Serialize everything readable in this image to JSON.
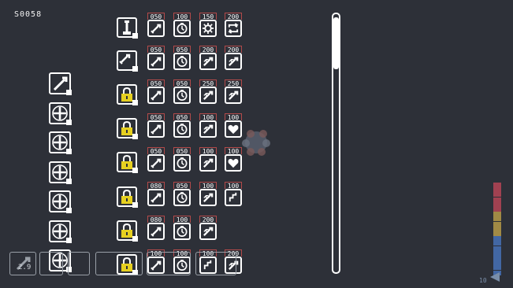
{
  "hud": {
    "counter": "S0058"
  },
  "left_slots": [
    {
      "icon": "sword-icon"
    },
    {
      "icon": "plus-icon"
    },
    {
      "icon": "plus-icon"
    },
    {
      "icon": "plus-icon"
    },
    {
      "icon": "plus-icon"
    },
    {
      "icon": "plus-icon"
    },
    {
      "icon": "plus-icon"
    }
  ],
  "rows": [
    {
      "weapon_icon": "wrench-icon",
      "locked": false,
      "items": [
        {
          "price": "050",
          "icon": "sword-icon"
        },
        {
          "price": "100",
          "icon": "clock-icon"
        },
        {
          "price": "150",
          "icon": "gear-icon"
        },
        {
          "price": "200",
          "icon": "cycle-icon"
        }
      ]
    },
    {
      "weapon_icon": "sword-icon",
      "locked": false,
      "items": [
        {
          "price": "050",
          "icon": "sword-icon"
        },
        {
          "price": "050",
          "icon": "clock-icon"
        },
        {
          "price": "200",
          "icon": "sword-up-icon"
        },
        {
          "price": "200",
          "icon": "sword-up-icon"
        }
      ]
    },
    {
      "weapon_icon": "lock-icon",
      "locked": true,
      "items": [
        {
          "price": "050",
          "icon": "sword-icon"
        },
        {
          "price": "050",
          "icon": "clock-icon"
        },
        {
          "price": "250",
          "icon": "sword-up-icon"
        },
        {
          "price": "250",
          "icon": "sword-up-icon"
        }
      ]
    },
    {
      "weapon_icon": "lock-icon",
      "locked": true,
      "items": [
        {
          "price": "050",
          "icon": "sword-icon"
        },
        {
          "price": "050",
          "icon": "clock-icon"
        },
        {
          "price": "100",
          "icon": "sword-up-icon"
        },
        {
          "price": "100",
          "icon": "heart-icon"
        }
      ]
    },
    {
      "weapon_icon": "lock-icon",
      "locked": true,
      "items": [
        {
          "price": "050",
          "icon": "sword-icon"
        },
        {
          "price": "050",
          "icon": "clock-icon"
        },
        {
          "price": "100",
          "icon": "sword-up-icon"
        },
        {
          "price": "100",
          "icon": "heart-icon"
        }
      ]
    },
    {
      "weapon_icon": "lock-icon",
      "locked": true,
      "items": [
        {
          "price": "080",
          "icon": "sword-icon"
        },
        {
          "price": "050",
          "icon": "clock-icon"
        },
        {
          "price": "100",
          "icon": "sword-up-icon"
        },
        {
          "price": "100",
          "icon": "chevron-up-icon"
        }
      ]
    },
    {
      "weapon_icon": "lock-icon",
      "locked": true,
      "items": [
        {
          "price": "080",
          "icon": "sword-icon"
        },
        {
          "price": "100",
          "icon": "clock-icon"
        },
        {
          "price": "200",
          "icon": "sword-up-icon"
        }
      ]
    },
    {
      "weapon_icon": "lock-icon",
      "locked": true,
      "items": [
        {
          "price": "100",
          "icon": "sword-icon"
        },
        {
          "price": "100",
          "icon": "clock-icon"
        },
        {
          "price": "100",
          "icon": "chevron-up-icon"
        },
        {
          "price": "200",
          "icon": "sword-up-icon"
        }
      ]
    }
  ],
  "bottom_bar": {
    "ammo_label": "2.9"
  },
  "meter": {
    "label": "10",
    "colors": [
      "#c8475a",
      "#c8475a",
      "#c8475a",
      "#c8475a",
      "#c8475a",
      "#c8475a",
      "#c8a84a",
      "#c8a84a",
      "#c8a84a",
      "#c8a84a",
      "#c8a84a",
      "#4a7ac8",
      "#4a7ac8",
      "#4a7ac8",
      "#4a7ac8",
      "#4a7ac8",
      "#4a7ac8",
      "#4a7ac8",
      "#4a7ac8"
    ]
  },
  "colors": {
    "background": "#2d3038",
    "lock": "#e6d020",
    "price_border": "#b34a4a"
  }
}
